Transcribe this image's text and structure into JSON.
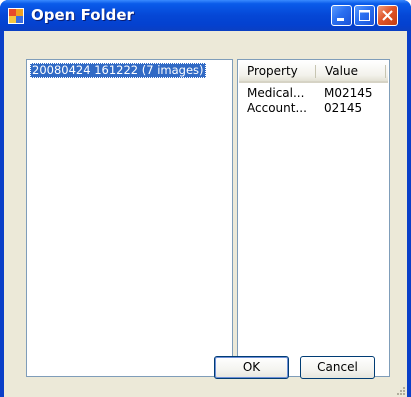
{
  "window": {
    "title": "Open Folder",
    "title_icon": "folder-app-icon",
    "controls": {
      "minimize_icon": "minimize-icon",
      "maximize_icon": "maximize-icon",
      "close_icon": "close-icon"
    }
  },
  "folders": {
    "items": [
      {
        "label": "20080424 161222 (7 images)",
        "selected": true
      }
    ]
  },
  "properties": {
    "columns": [
      "Property",
      "Value"
    ],
    "rows": [
      {
        "property": "Medical...",
        "value": "M02145"
      },
      {
        "property": "Account...",
        "value": "02145"
      }
    ]
  },
  "buttons": {
    "ok_label": "OK",
    "cancel_label": "Cancel"
  },
  "colors": {
    "titlebar": "#0547d6",
    "selection": "#316ac5",
    "dialog_face": "#ece9d8",
    "close_button": "#e0552a"
  }
}
